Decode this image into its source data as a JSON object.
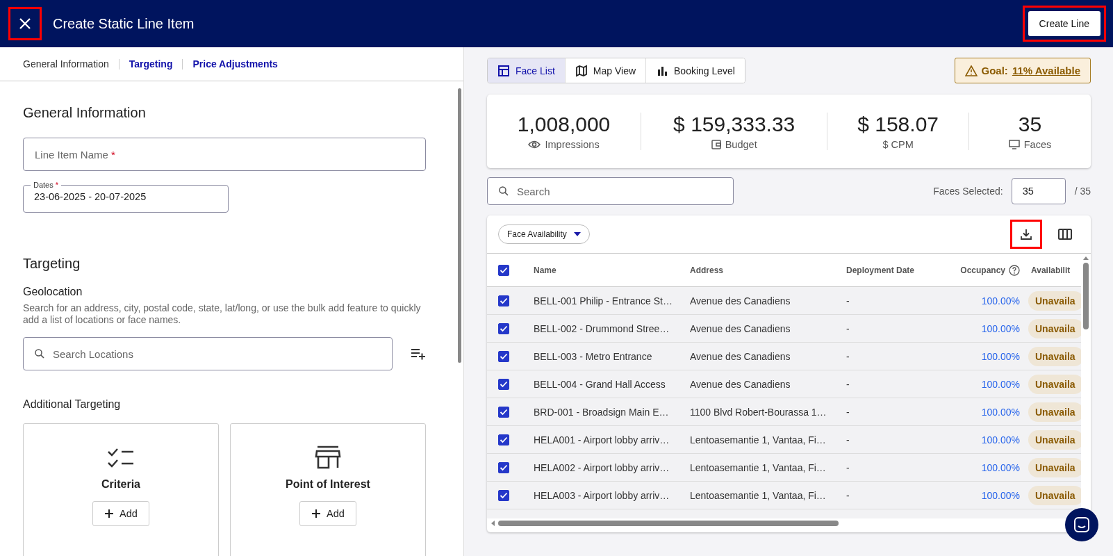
{
  "header": {
    "title": "Create Static Line Item",
    "close_button": {
      "highlighted": true
    },
    "create_button": {
      "label": "Create Line",
      "highlighted": true
    }
  },
  "left": {
    "tabs": [
      {
        "label": "General Information",
        "selected": true
      },
      {
        "label": "Targeting",
        "selected": false
      },
      {
        "label": "Price Adjustments",
        "selected": false
      }
    ],
    "general": {
      "heading": "General Information",
      "name_field": {
        "placeholder": "Line Item Name",
        "required_mark": "*"
      },
      "dates_field": {
        "label": "Dates",
        "required_mark": "*",
        "value": "23-06-2025 - 20-07-2025"
      }
    },
    "targeting": {
      "heading": "Targeting",
      "geolocation": {
        "title": "Geolocation",
        "description": "Search for an address, city, postal code, state, lat/long, or use the bulk add feature to quickly add a list of locations or face names.",
        "search_placeholder": "Search Locations"
      },
      "additional_title": "Additional Targeting",
      "cards": [
        {
          "title": "Criteria",
          "button": "Add"
        },
        {
          "title": "Point of Interest",
          "button": "Add"
        }
      ]
    }
  },
  "right": {
    "views": [
      {
        "label": "Face List",
        "selected": true
      },
      {
        "label": "Map View",
        "selected": false
      },
      {
        "label": "Booking Level",
        "selected": false
      }
    ],
    "goal": {
      "label": "Goal:",
      "link": "11% Available"
    },
    "stats": [
      {
        "value": "1,008,000",
        "label": "Impressions"
      },
      {
        "value": "$ 159,333.33",
        "label": "Budget"
      },
      {
        "value": "$ 158.07",
        "label": "$ CPM"
      },
      {
        "value": "35",
        "label": "Faces"
      }
    ],
    "search_placeholder": "Search",
    "faces_selected": {
      "label": "Faces Selected:",
      "value": "35",
      "total": "/ 35"
    },
    "table": {
      "filter": "Face Availability",
      "download_highlighted": true,
      "select_all": true,
      "columns": [
        "Name",
        "Address",
        "Deployment Date",
        "Occupancy",
        "Availabilit"
      ],
      "rows": [
        {
          "checked": true,
          "name": "BELL-001 Philip - Entrance St…",
          "address": "Avenue des Canadiens",
          "date": "-",
          "occupancy": "100.00%",
          "availability": "Unavaila"
        },
        {
          "checked": true,
          "name": "BELL-002 - Drummond Stree…",
          "address": "Avenue des Canadiens",
          "date": "-",
          "occupancy": "100.00%",
          "availability": "Unavaila"
        },
        {
          "checked": true,
          "name": "BELL-003 - Metro Entrance",
          "address": "Avenue des Canadiens",
          "date": "-",
          "occupancy": "100.00%",
          "availability": "Unavaila"
        },
        {
          "checked": true,
          "name": "BELL-004 - Grand Hall Access",
          "address": "Avenue des Canadiens",
          "date": "-",
          "occupancy": "100.00%",
          "availability": "Unavaila"
        },
        {
          "checked": true,
          "name": "BRD-001 - Broadsign Main E…",
          "address": "1100 Blvd Robert-Bourassa 1…",
          "date": "-",
          "occupancy": "100.00%",
          "availability": "Unavaila"
        },
        {
          "checked": true,
          "name": "HELA001 - Airport lobby arriv…",
          "address": "Lentoasemantie 1, Vantaa, Fi…",
          "date": "-",
          "occupancy": "100.00%",
          "availability": "Unavaila"
        },
        {
          "checked": true,
          "name": "HELA002 - Airport lobby arriv…",
          "address": "Lentoasemantie 1, Vantaa, Fi…",
          "date": "-",
          "occupancy": "100.00%",
          "availability": "Unavaila"
        },
        {
          "checked": true,
          "name": "HELA003 - Airport lobby arriv…",
          "address": "Lentoasemantie 1, Vantaa, Fi…",
          "date": "-",
          "occupancy": "100.00%",
          "availability": "Unavaila"
        }
      ]
    }
  }
}
